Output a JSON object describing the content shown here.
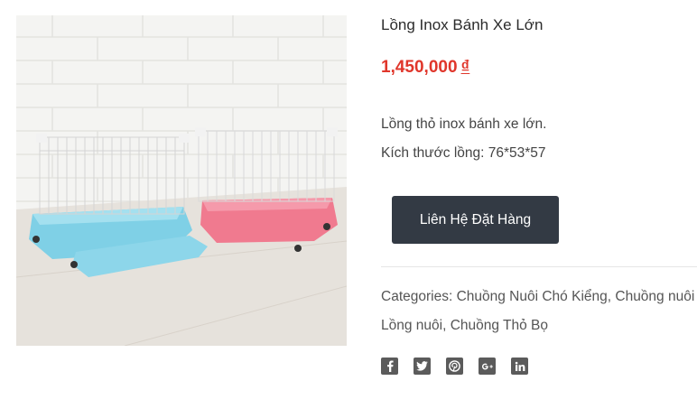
{
  "product": {
    "title": "Lồng Inox Bánh Xe Lớn",
    "price": "1,450,000",
    "currency": "₫",
    "description": [
      "Lồng thỏ inox bánh xe lớn.",
      "Kích thước lồng: 76*53*57"
    ],
    "order_button_label": "Liên Hệ Đặt Hàng",
    "categories_label": "Categories:",
    "categories": [
      "Chuồng Nuôi Chó Kiểng",
      "Chuồng nuôi Mèo",
      "Lồng nuôi",
      "Chuồng Thỏ Bọ"
    ],
    "separator": ",",
    "share_icons": [
      "facebook-icon",
      "twitter-icon",
      "pinterest-icon",
      "google-plus-icon",
      "linkedin-icon"
    ]
  },
  "colors": {
    "price": "#e0362b",
    "button": "#333a44",
    "cage_blue": "#7fd0e6",
    "cage_pink": "#f07a8f"
  }
}
